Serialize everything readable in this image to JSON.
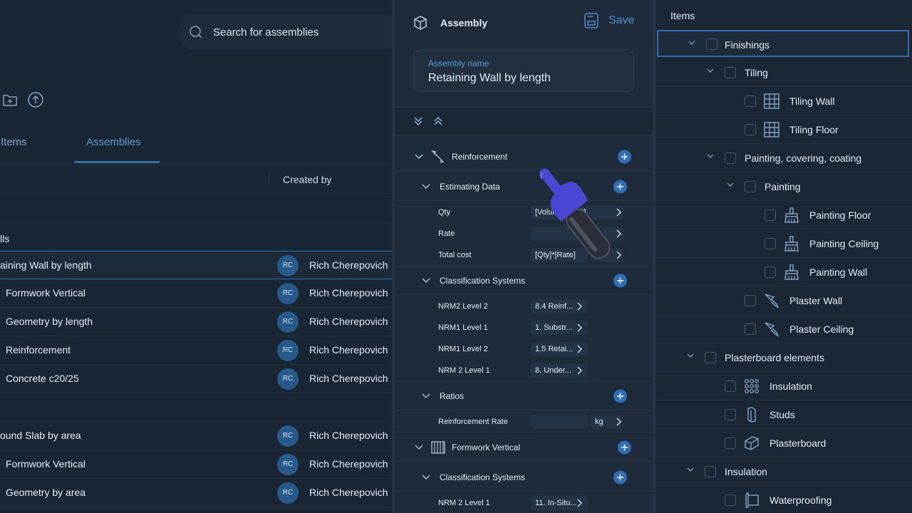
{
  "search": {
    "placeholder": "Search for assemblies"
  },
  "tabs": [
    {
      "label": "Items"
    },
    {
      "label": "Assemblies"
    }
  ],
  "table": {
    "created_by_header": "Created by"
  },
  "groups": [
    {
      "label": "lls"
    }
  ],
  "assemblies": [
    {
      "name": "aining Wall by length",
      "initials": "RC",
      "creator": "Rich Cherepovich"
    },
    {
      "name": "Formwork Vertical",
      "initials": "RC",
      "creator": "Rich Cherepovich"
    },
    {
      "name": "Geometry by length",
      "initials": "RC",
      "creator": "Rich Cherepovich"
    },
    {
      "name": "Reinforcement",
      "initials": "RC",
      "creator": "Rich Cherepovich"
    },
    {
      "name": "Concrete c20/25",
      "initials": "RC",
      "creator": "Rich Cherepovich"
    },
    {
      "name": "ound Slab by area",
      "initials": "RC",
      "creator": "Rich Cherepovich"
    },
    {
      "name": "Formwork Vertical",
      "initials": "RC",
      "creator": "Rich Cherepovich"
    },
    {
      "name": "Geometry by area",
      "initials": "RC",
      "creator": "Rich Cherepovich"
    }
  ],
  "editor": {
    "title": "Assembly",
    "save_label": "Save",
    "name_label": "Assembly name",
    "name_value": "Retaining Wall by length",
    "sections": {
      "reinforcement": "Reinforcement",
      "estimating": "Estimating Data",
      "classification1": "Classification Systems",
      "ratios": "Ratios",
      "formwork": "Formwork Vertical",
      "classification2": "Classification Systems"
    },
    "estimating_rows": [
      {
        "label": "Qty",
        "value": "[Volume] [Unit]",
        "unit": ""
      },
      {
        "label": "Rate",
        "value": "",
        "unit": "$"
      },
      {
        "label": "Total cost",
        "value": "[Qty]*[Rate]",
        "unit": "$"
      }
    ],
    "classification_rows": [
      {
        "label": "NRM2 Level 2",
        "value": "8.4 Reinf..."
      },
      {
        "label": "NRM1 Level 1",
        "value": "1. Substr..."
      },
      {
        "label": "NRM1 Level 2",
        "value": "1.5 Retai..."
      },
      {
        "label": "NRM 2 Level 1",
        "value": "8. Under..."
      }
    ],
    "ratio_rows": [
      {
        "label": "Reinforcement Rate",
        "value": "",
        "unit": "kg"
      }
    ],
    "formwork_rows": [
      {
        "label": "NRM 2 Level 1",
        "value": "11. In-Situ..."
      }
    ]
  },
  "items_panel": {
    "title": "Items",
    "tree": [
      {
        "label": "Finishings",
        "icon": "none"
      },
      {
        "label": "Tiling",
        "icon": "none"
      },
      {
        "label": "Tiling Wall",
        "icon": "tile-icon"
      },
      {
        "label": "Tiling Floor",
        "icon": "tile-icon"
      },
      {
        "label": "Painting, covering, coating",
        "icon": "none"
      },
      {
        "label": "Painting",
        "icon": "none"
      },
      {
        "label": "Painting Floor",
        "icon": "brush-icon"
      },
      {
        "label": "Painting Ceiling",
        "icon": "brush-icon"
      },
      {
        "label": "Painting Wall",
        "icon": "brush-icon"
      },
      {
        "label": "Plaster Wall",
        "icon": "trowel-icon"
      },
      {
        "label": "Plaster Ceiling",
        "icon": "trowel-icon"
      },
      {
        "label": "Plasterboard elements",
        "icon": "none"
      },
      {
        "label": "Insulation",
        "icon": "grid-dots-icon"
      },
      {
        "label": "Studs",
        "icon": "stud-icon"
      },
      {
        "label": "Plasterboard",
        "icon": "board-icon"
      },
      {
        "label": "Insulation",
        "icon": "none"
      },
      {
        "label": "Waterproofing",
        "icon": "membrane-icon"
      }
    ]
  },
  "colors": {
    "accent": "#2f6fae",
    "plus": "#2c6fb6",
    "bg": "#1b2634"
  }
}
